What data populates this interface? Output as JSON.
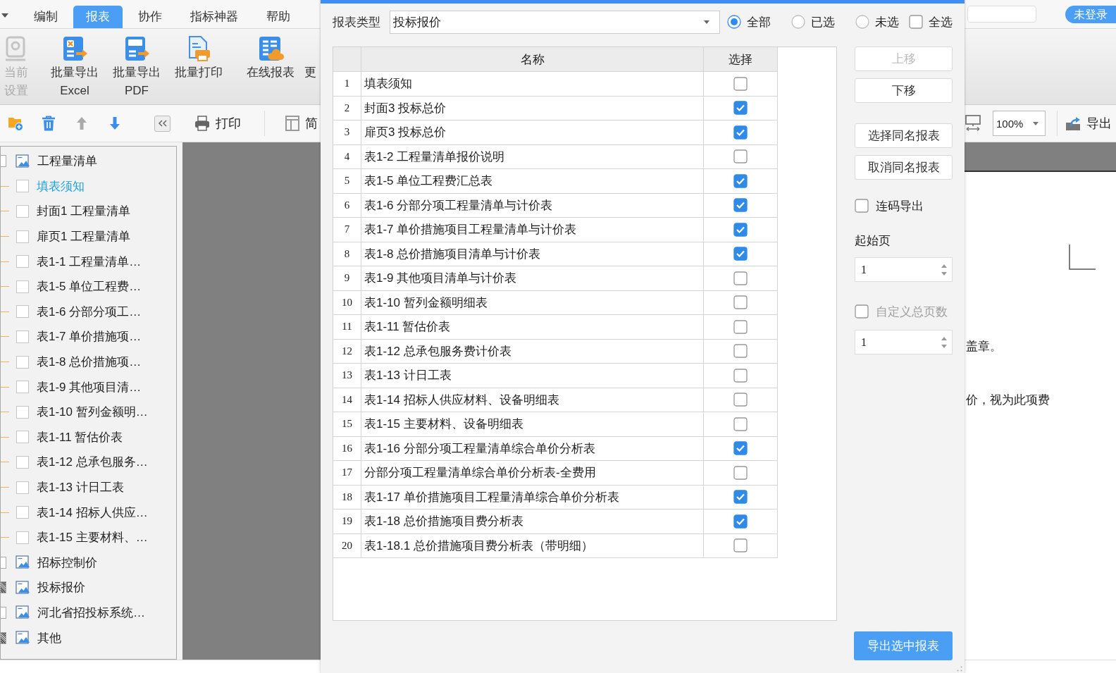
{
  "menu": {
    "tabs": [
      {
        "label": "编制",
        "selected": false
      },
      {
        "label": "报表",
        "selected": true
      },
      {
        "label": "协作",
        "selected": false
      },
      {
        "label": "指标神器",
        "selected": false
      },
      {
        "label": "帮助",
        "selected": false
      }
    ],
    "login_button": "未登录"
  },
  "ribbon": [
    {
      "kind": "settings",
      "lines": [
        "当前",
        "设置"
      ],
      "disabled": true
    },
    {
      "kind": "excel",
      "lines": [
        "批量导出",
        "Excel"
      ],
      "disabled": false
    },
    {
      "kind": "pdf",
      "lines": [
        "批量导出",
        "PDF"
      ],
      "disabled": false
    },
    {
      "kind": "print",
      "lines": [
        "批量打印"
      ],
      "disabled": false
    },
    {
      "kind": "online",
      "lines": [
        "在线报表"
      ],
      "disabled": false
    },
    {
      "kind": "more",
      "lines": [
        "更"
      ],
      "disabled": false
    }
  ],
  "tree_toolbar": [
    {
      "kind": "add-folder",
      "disabled": false
    },
    {
      "kind": "delete",
      "disabled": false
    },
    {
      "kind": "move-up",
      "disabled": true
    },
    {
      "kind": "move-down",
      "disabled": false
    }
  ],
  "tree": [
    {
      "label": "工程量清单",
      "selected": false,
      "partial": false,
      "children": [
        {
          "label": "填表须知",
          "selected": true,
          "checked": false
        },
        {
          "label": "封面1 工程量清单",
          "selected": false,
          "checked": false
        },
        {
          "label": "扉页1 工程量清单",
          "selected": false,
          "checked": false
        },
        {
          "label": "表1-1 工程量清单…",
          "selected": false,
          "checked": false
        },
        {
          "label": "表1-5 单位工程费…",
          "selected": false,
          "checked": false
        },
        {
          "label": "表1-6 分部分项工…",
          "selected": false,
          "checked": false
        },
        {
          "label": "表1-7 单价措施项…",
          "selected": false,
          "checked": false
        },
        {
          "label": "表1-8 总价措施项…",
          "selected": false,
          "checked": false
        },
        {
          "label": "表1-9 其他项目清…",
          "selected": false,
          "checked": false
        },
        {
          "label": "表1-10 暂列金额明…",
          "selected": false,
          "checked": false
        },
        {
          "label": "表1-11 暂估价表",
          "selected": false,
          "checked": false
        },
        {
          "label": "表1-12 总承包服务…",
          "selected": false,
          "checked": false
        },
        {
          "label": "表1-13 计日工表",
          "selected": false,
          "checked": false
        },
        {
          "label": "表1-14 招标人供应…",
          "selected": false,
          "checked": false
        },
        {
          "label": "表1-15 主要材料、…",
          "selected": false,
          "checked": false
        }
      ]
    },
    {
      "label": "招标控制价",
      "selected": false,
      "partial": false
    },
    {
      "label": "投标报价",
      "selected": false,
      "partial": true
    },
    {
      "label": "河北省招投标系统…",
      "selected": false,
      "partial": false
    },
    {
      "label": "其他",
      "selected": false,
      "partial": true
    }
  ],
  "preview_toolbar": {
    "print": "打印",
    "layout": "简",
    "zoom": "100%",
    "export": "导出"
  },
  "preview_page": {
    "lines": [
      "盖章。",
      "价，视为此项费"
    ]
  },
  "dialog": {
    "report_type": {
      "label": "报表类型",
      "value": "投标报价"
    },
    "filters": [
      {
        "label": "全部",
        "selected": true
      },
      {
        "label": "已选",
        "selected": false
      },
      {
        "label": "未选",
        "selected": false
      }
    ],
    "select_all": {
      "label": "全选",
      "checked": false
    },
    "table": {
      "columns": [
        "名称",
        "选择"
      ],
      "rows": [
        {
          "index": "1",
          "name": "填表须知",
          "checked": false
        },
        {
          "index": "2",
          "name": "封面3 投标总价",
          "checked": true
        },
        {
          "index": "3",
          "name": "扉页3 投标总价",
          "checked": true
        },
        {
          "index": "4",
          "name": "表1-2 工程量清单报价说明",
          "checked": false
        },
        {
          "index": "5",
          "name": "表1-5 单位工程费汇总表",
          "checked": true
        },
        {
          "index": "6",
          "name": "表1-6 分部分项工程量清单与计价表",
          "checked": true
        },
        {
          "index": "7",
          "name": "表1-7 单价措施项目工程量清单与计价表",
          "checked": true
        },
        {
          "index": "8",
          "name": "表1-8 总价措施项目清单与计价表",
          "checked": true
        },
        {
          "index": "9",
          "name": "表1-9 其他项目清单与计价表",
          "checked": false
        },
        {
          "index": "10",
          "name": "表1-10 暂列金额明细表",
          "checked": false
        },
        {
          "index": "11",
          "name": "表1-11 暂估价表",
          "checked": false
        },
        {
          "index": "12",
          "name": "表1-12 总承包服务费计价表",
          "checked": false
        },
        {
          "index": "13",
          "name": "表1-13 计日工表",
          "checked": false
        },
        {
          "index": "14",
          "name": "表1-14 招标人供应材料、设备明细表",
          "checked": false
        },
        {
          "index": "15",
          "name": "表1-15 主要材料、设备明细表",
          "checked": false
        },
        {
          "index": "16",
          "name": "表1-16 分部分项工程量清单综合单价分析表",
          "checked": true
        },
        {
          "index": "17",
          "name": "分部分项工程量清单综合单价分析表-全费用",
          "checked": false
        },
        {
          "index": "18",
          "name": "表1-17 单价措施项目工程量清单综合单价分析表",
          "checked": true
        },
        {
          "index": "19",
          "name": "表1-18 总价措施项目费分析表",
          "checked": true
        },
        {
          "index": "20",
          "name": "表1-18.1 总价措施项目费分析表（带明细）",
          "checked": false
        }
      ]
    },
    "move_buttons": [
      {
        "label": "上移",
        "disabled": true
      },
      {
        "label": "下移",
        "disabled": false
      }
    ],
    "same_name_buttons": [
      {
        "label": "选择同名报表",
        "disabled": false
      },
      {
        "label": "取消同名报表",
        "disabled": false
      }
    ],
    "continuous_export": {
      "label": "连码导出",
      "checked": false
    },
    "start_page": {
      "label": "起始页",
      "value": "1"
    },
    "custom_total_pages": {
      "label": "自定义总页数",
      "checked": false,
      "disabled": true,
      "value": "1"
    },
    "export_button": "导出选中报表"
  }
}
